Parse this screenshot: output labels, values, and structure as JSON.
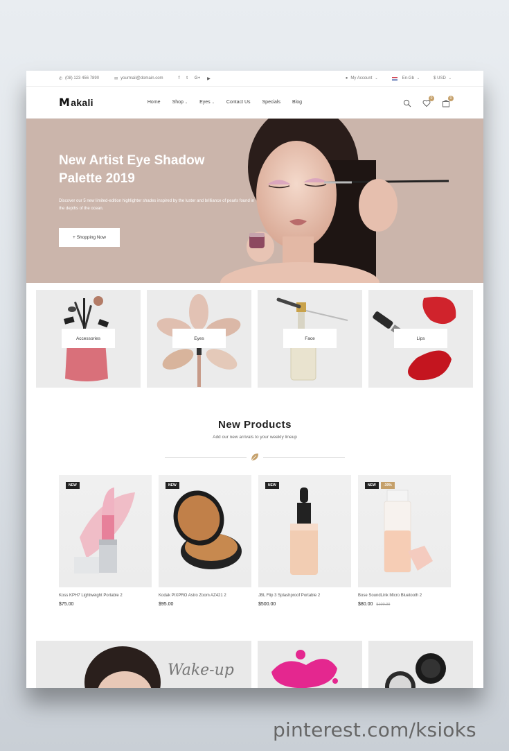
{
  "topbar": {
    "phone": "(08) 123 456 7890",
    "email": "yourmail@domain.com",
    "social": [
      "f",
      "t",
      "G+",
      "▶"
    ],
    "account": "My Account",
    "language": "En-Gb",
    "currency": "$ USD"
  },
  "header": {
    "logo": "akali",
    "logo_initial": "M",
    "nav": [
      "Home",
      "Shop",
      "Eyes",
      "Contact Us",
      "Specials",
      "Blog"
    ],
    "wishlist_count": "0",
    "cart_count": "0"
  },
  "hero": {
    "title": "New Artist Eye Shadow Palette 2019",
    "description": "Discover our 5 new limited-edition highlighter shades inspired by the luster and brilliance of pearls found in the depths of the ocean.",
    "button": "+ Shopping Now"
  },
  "categories": [
    "Accessories",
    "Eyes",
    "Face",
    "Lips"
  ],
  "new_products": {
    "title": "New Products",
    "subtitle": "Add our new arrivals to your weekly lineup",
    "new_tag": "NEW",
    "items": [
      {
        "name": "Koss KPH7 Lightweight Portable 2",
        "price": "$75.00",
        "old_price": "",
        "discount": ""
      },
      {
        "name": "Kodak PIXPRO Astro Zoom AZ421 2",
        "price": "$95.00",
        "old_price": "",
        "discount": ""
      },
      {
        "name": "JBL Flip 3 Splashproof Portable 2",
        "price": "$500.00",
        "old_price": "",
        "discount": ""
      },
      {
        "name": "Bose SoundLink Micro Bluetooth 2",
        "price": "$80.00",
        "old_price": "$100.00",
        "discount": "-30%"
      }
    ]
  },
  "banner": {
    "script_text": "Wake-up"
  },
  "watermark": "pinterest.com/ksioks",
  "colors": {
    "accent": "#c5a06a",
    "hero_bg": "#cbb5ab"
  }
}
